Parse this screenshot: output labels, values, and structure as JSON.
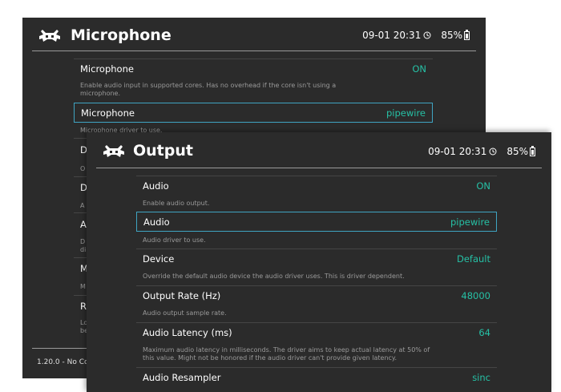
{
  "back_window": {
    "title": "Microphone",
    "datetime": "09-01 20:31",
    "battery": "85%",
    "settings": [
      {
        "label": "Microphone",
        "value": "ON",
        "description": "Enable audio input in supported cores. Has no overhead if the core isn't using a microphone."
      },
      {
        "label": "Microphone",
        "value": "pipewire",
        "description": "Microphone driver to use."
      }
    ],
    "clipped_rows": [
      {
        "label": "D",
        "description": "O"
      },
      {
        "label": "D",
        "description": "A"
      },
      {
        "label": "A",
        "description": "D",
        "description2": "di"
      },
      {
        "label": "M",
        "description": "M"
      },
      {
        "label": "R",
        "description": "Lo",
        "description2": "be"
      }
    ],
    "footer": "1.20.0 - No Co"
  },
  "front_window": {
    "title": "Output",
    "datetime": "09-01 20:31",
    "battery": "85%",
    "settings": [
      {
        "label": "Audio",
        "value": "ON",
        "description": "Enable audio output."
      },
      {
        "label": "Audio",
        "value": "pipewire",
        "description": "Audio driver to use."
      },
      {
        "label": "Device",
        "value": "Default",
        "description": "Override the default audio device the audio driver uses. This is driver dependent."
      },
      {
        "label": "Output Rate (Hz)",
        "value": "48000",
        "description": "Audio output sample rate."
      },
      {
        "label": "Audio Latency (ms)",
        "value": "64",
        "description": "Maximum audio latency in milliseconds. The driver aims to keep actual latency at 50% of this value. Might not be honored if the audio driver can't provide given latency."
      },
      {
        "label": "Audio Resampler",
        "value": "sinc",
        "description": ""
      }
    ]
  },
  "colors": {
    "background": "#2b2b2b",
    "value_accent": "#26c0a5",
    "selection_border": "#3fa4c2",
    "description_text": "#9a9a9a"
  },
  "icons": [
    "retroarch-logo-icon",
    "clock-icon",
    "battery-icon"
  ]
}
